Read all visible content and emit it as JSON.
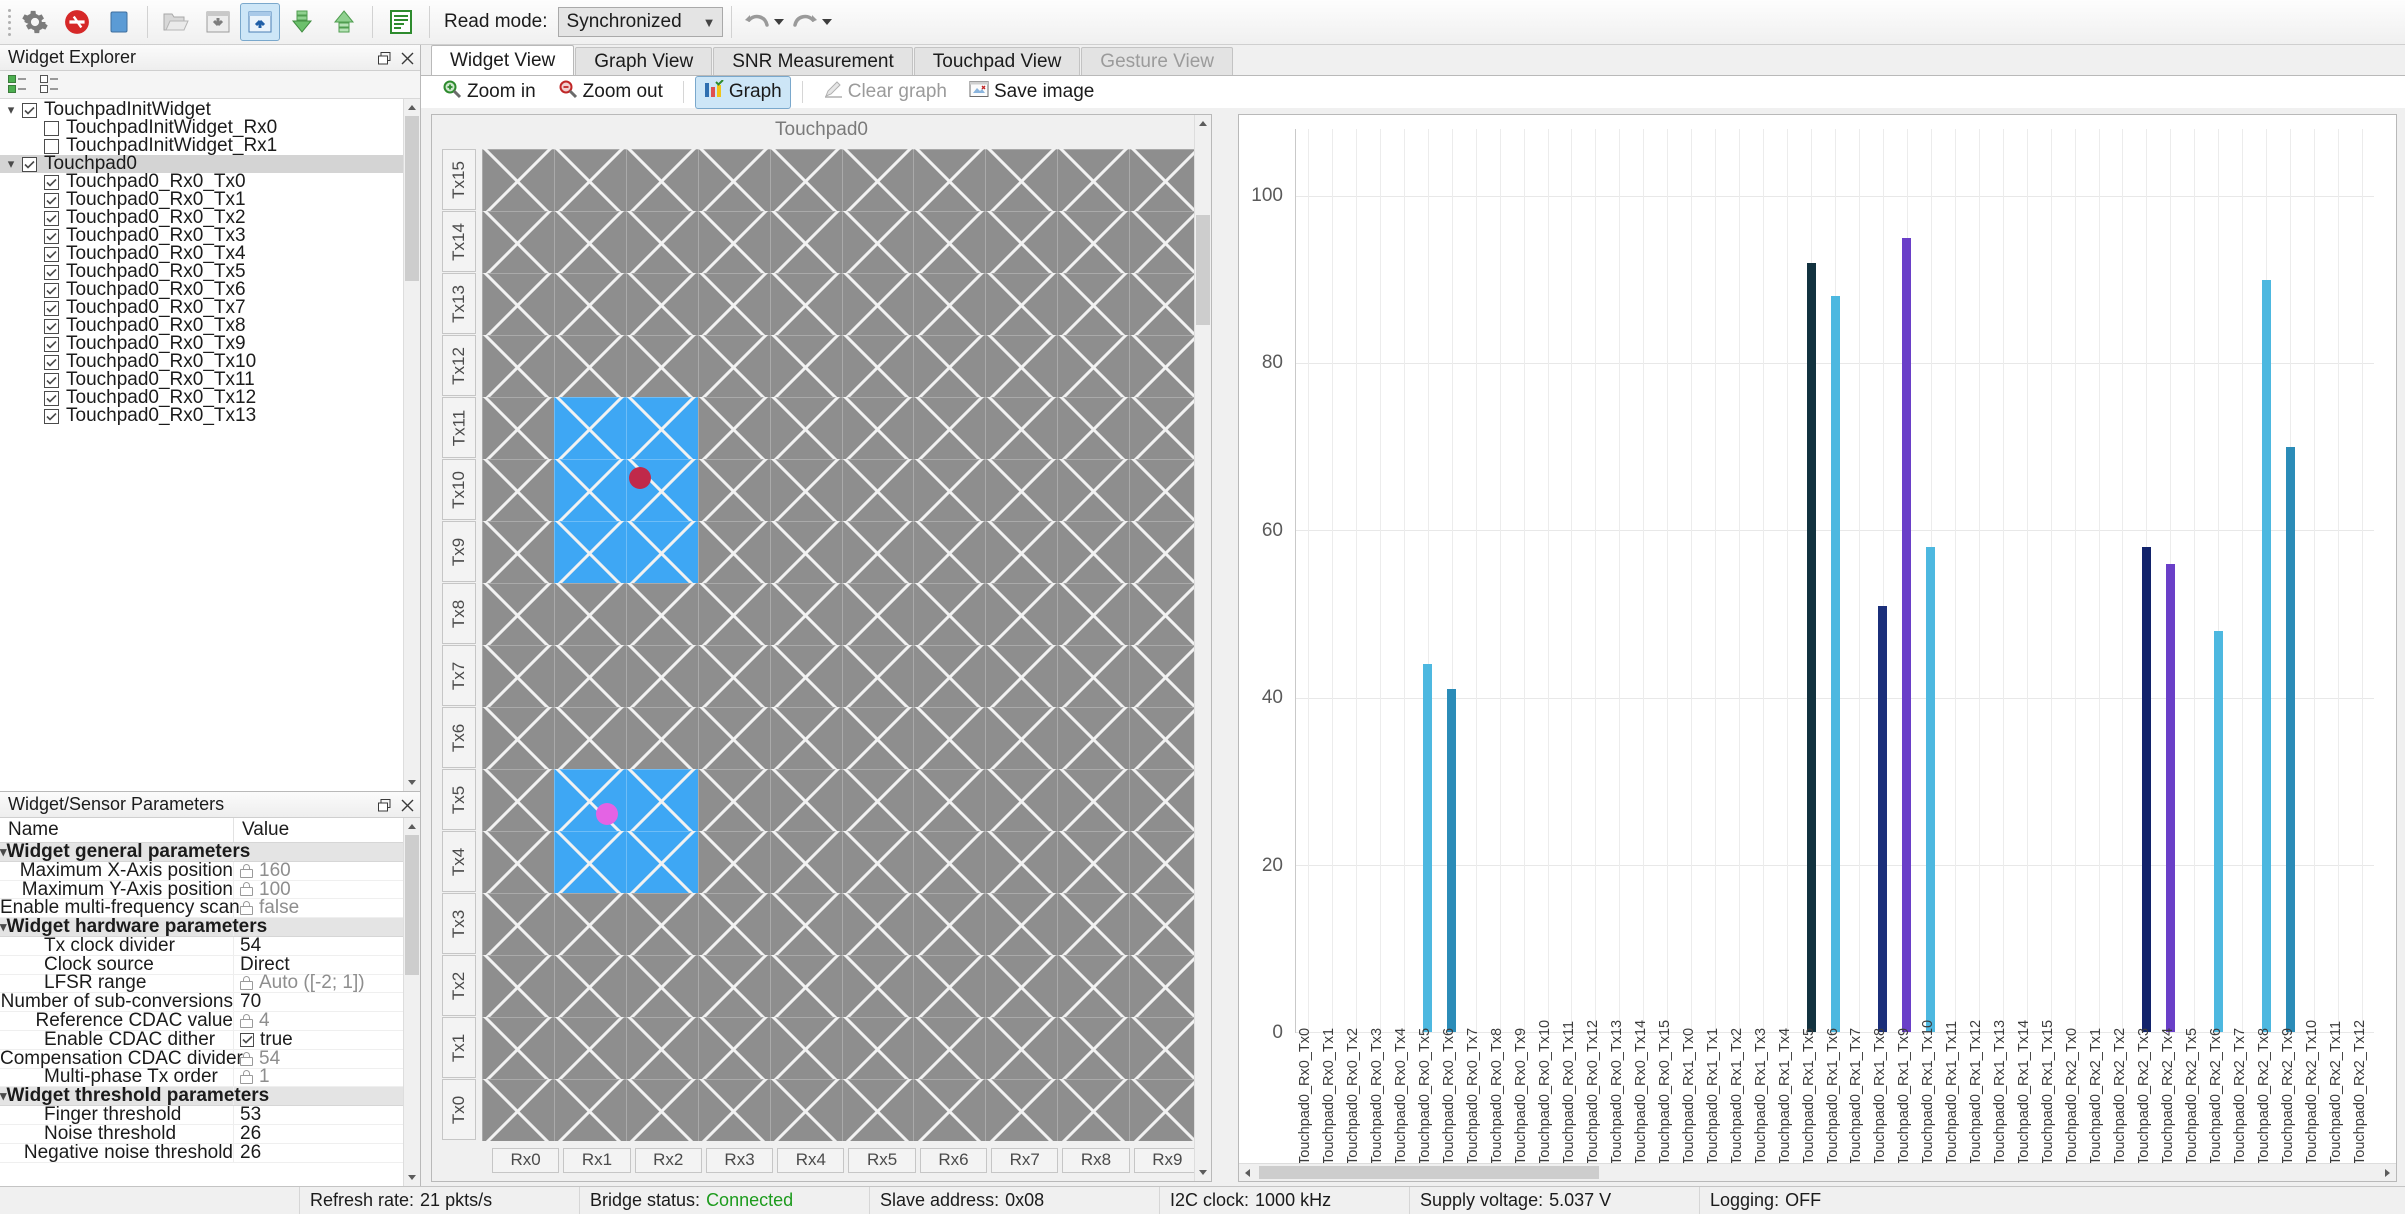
{
  "toolbar": {
    "buttons": [
      {
        "name": "settings-icon",
        "label": "Settings"
      },
      {
        "name": "disconnect-icon",
        "label": "Disconnect"
      },
      {
        "name": "stop-icon",
        "label": "Stop"
      },
      {
        "name": "open-file-icon",
        "label": "Open configuration"
      },
      {
        "name": "read-from-device-icon",
        "label": "Read from device"
      },
      {
        "name": "write-to-device-icon",
        "label": "Write to device"
      },
      {
        "name": "apply-to-device-icon",
        "label": "Apply to device"
      },
      {
        "name": "upload-to-device-icon",
        "label": "Upload to device"
      },
      {
        "name": "log-icon",
        "label": "Log"
      }
    ],
    "read_mode_label": "Read mode:",
    "read_mode_value": "Synchronized",
    "undo_label": "Undo",
    "redo_label": "Redo"
  },
  "widget_explorer": {
    "title": "Widget Explorer",
    "check_all_label": "Check all",
    "uncheck_all_label": "Uncheck all",
    "items": [
      {
        "label": "TouchpadInitWidget",
        "level": 0,
        "checked": true,
        "expandable": true,
        "selected": false
      },
      {
        "label": "TouchpadInitWidget_Rx0",
        "level": 1,
        "checked": false,
        "expandable": false,
        "selected": false
      },
      {
        "label": "TouchpadInitWidget_Rx1",
        "level": 1,
        "checked": false,
        "expandable": false,
        "selected": false
      },
      {
        "label": "Touchpad0",
        "level": 0,
        "checked": true,
        "expandable": true,
        "selected": true
      },
      {
        "label": "Touchpad0_Rx0_Tx0",
        "level": 1,
        "checked": true,
        "expandable": false,
        "selected": false
      },
      {
        "label": "Touchpad0_Rx0_Tx1",
        "level": 1,
        "checked": true,
        "expandable": false,
        "selected": false
      },
      {
        "label": "Touchpad0_Rx0_Tx2",
        "level": 1,
        "checked": true,
        "expandable": false,
        "selected": false
      },
      {
        "label": "Touchpad0_Rx0_Tx3",
        "level": 1,
        "checked": true,
        "expandable": false,
        "selected": false
      },
      {
        "label": "Touchpad0_Rx0_Tx4",
        "level": 1,
        "checked": true,
        "expandable": false,
        "selected": false
      },
      {
        "label": "Touchpad0_Rx0_Tx5",
        "level": 1,
        "checked": true,
        "expandable": false,
        "selected": false
      },
      {
        "label": "Touchpad0_Rx0_Tx6",
        "level": 1,
        "checked": true,
        "expandable": false,
        "selected": false
      },
      {
        "label": "Touchpad0_Rx0_Tx7",
        "level": 1,
        "checked": true,
        "expandable": false,
        "selected": false
      },
      {
        "label": "Touchpad0_Rx0_Tx8",
        "level": 1,
        "checked": true,
        "expandable": false,
        "selected": false
      },
      {
        "label": "Touchpad0_Rx0_Tx9",
        "level": 1,
        "checked": true,
        "expandable": false,
        "selected": false
      },
      {
        "label": "Touchpad0_Rx0_Tx10",
        "level": 1,
        "checked": true,
        "expandable": false,
        "selected": false
      },
      {
        "label": "Touchpad0_Rx0_Tx11",
        "level": 1,
        "checked": true,
        "expandable": false,
        "selected": false
      },
      {
        "label": "Touchpad0_Rx0_Tx12",
        "level": 1,
        "checked": true,
        "expandable": false,
        "selected": false
      },
      {
        "label": "Touchpad0_Rx0_Tx13",
        "level": 1,
        "checked": true,
        "expandable": false,
        "selected": false
      }
    ]
  },
  "parameters_panel": {
    "title": "Widget/Sensor Parameters",
    "col_name": "Name",
    "col_value": "Value",
    "rows": [
      {
        "name": "Widget general parameters",
        "value": "",
        "group": true
      },
      {
        "name": "Maximum X-Axis position",
        "value": "160",
        "locked": true
      },
      {
        "name": "Maximum Y-Axis position",
        "value": "100",
        "locked": true
      },
      {
        "name": "Enable multi-frequency scan",
        "value": "false",
        "locked": true
      },
      {
        "name": "Widget hardware parameters",
        "value": "",
        "group": true
      },
      {
        "name": "Tx clock divider",
        "value": "54"
      },
      {
        "name": "Clock source",
        "value": "Direct"
      },
      {
        "name": "LFSR range",
        "value": "Auto ([-2; 1])",
        "locked": true
      },
      {
        "name": "Number of sub-conversions",
        "value": "70"
      },
      {
        "name": "Reference CDAC value",
        "value": "4",
        "locked": true
      },
      {
        "name": "Enable CDAC dither",
        "value": "true",
        "checkbox": true
      },
      {
        "name": "Compensation CDAC divider",
        "value": "54",
        "locked": true
      },
      {
        "name": "Multi-phase Tx order",
        "value": "1",
        "locked": true
      },
      {
        "name": "Widget threshold parameters",
        "value": "",
        "group": true
      },
      {
        "name": "Finger threshold",
        "value": "53"
      },
      {
        "name": "Noise threshold",
        "value": "26"
      },
      {
        "name": "Negative noise threshold",
        "value": "26"
      }
    ]
  },
  "tabs": [
    {
      "label": "Widget View",
      "active": true,
      "disabled": false
    },
    {
      "label": "Graph View",
      "active": false,
      "disabled": false
    },
    {
      "label": "SNR Measurement",
      "active": false,
      "disabled": false
    },
    {
      "label": "Touchpad View",
      "active": false,
      "disabled": false
    },
    {
      "label": "Gesture View",
      "active": false,
      "disabled": true
    }
  ],
  "view_toolbar": [
    {
      "label": "Zoom in",
      "icon": "zoom-in-icon",
      "active": false,
      "disabled": false
    },
    {
      "label": "Zoom out",
      "icon": "zoom-out-icon",
      "active": false,
      "disabled": false
    },
    {
      "label": "Graph",
      "icon": "graph-icon",
      "active": true,
      "disabled": false
    },
    {
      "label": "Clear graph",
      "icon": "clear-graph-icon",
      "active": false,
      "disabled": true
    },
    {
      "label": "Save image",
      "icon": "save-image-icon",
      "active": false,
      "disabled": false
    }
  ],
  "touchpad_view": {
    "title": "Touchpad0",
    "tx_labels": [
      "Tx15",
      "Tx14",
      "Tx13",
      "Tx12",
      "Tx11",
      "Tx10",
      "Tx9",
      "Tx8",
      "Tx7",
      "Tx6",
      "Tx5",
      "Tx4",
      "Tx3",
      "Tx2",
      "Tx1",
      "Tx0"
    ],
    "rx_labels": [
      "Rx0",
      "Rx1",
      "Rx2",
      "Rx3",
      "Rx4",
      "Rx5",
      "Rx6",
      "Rx7",
      "Rx8",
      "Rx9"
    ],
    "active_cells": [
      {
        "col": 1,
        "row": 4
      },
      {
        "col": 2,
        "row": 4
      },
      {
        "col": 1,
        "row": 5
      },
      {
        "col": 2,
        "row": 5
      },
      {
        "col": 1,
        "row": 6
      },
      {
        "col": 2,
        "row": 6
      },
      {
        "col": 1,
        "row": 10
      },
      {
        "col": 2,
        "row": 10
      },
      {
        "col": 1,
        "row": 11
      },
      {
        "col": 2,
        "row": 11
      }
    ],
    "touches": [
      {
        "id": "touch-0",
        "color": "#c0294a",
        "col_pct": 22.0,
        "row_pct": 33.2
      },
      {
        "id": "touch-1",
        "color": "#e463e4",
        "col_pct": 17.4,
        "row_pct": 67.0
      }
    ],
    "cell_color": "#8e8e8e",
    "active_color": "#3ea7f4"
  },
  "chart_data": {
    "type": "bar",
    "title": "",
    "xlabel": "",
    "ylabel": "",
    "ylim": [
      0,
      108
    ],
    "yticks": [
      0,
      20,
      40,
      60,
      80,
      100
    ],
    "grid": true,
    "legend": "none",
    "categories": [
      "Touchpad0_Rx0_Tx0",
      "Touchpad0_Rx0_Tx1",
      "Touchpad0_Rx0_Tx2",
      "Touchpad0_Rx0_Tx3",
      "Touchpad0_Rx0_Tx4",
      "Touchpad0_Rx0_Tx5",
      "Touchpad0_Rx0_Tx6",
      "Touchpad0_Rx0_Tx7",
      "Touchpad0_Rx0_Tx8",
      "Touchpad0_Rx0_Tx9",
      "Touchpad0_Rx0_Tx10",
      "Touchpad0_Rx0_Tx11",
      "Touchpad0_Rx0_Tx12",
      "Touchpad0_Rx0_Tx13",
      "Touchpad0_Rx0_Tx14",
      "Touchpad0_Rx0_Tx15",
      "Touchpad0_Rx1_Tx0",
      "Touchpad0_Rx1_Tx1",
      "Touchpad0_Rx1_Tx2",
      "Touchpad0_Rx1_Tx3",
      "Touchpad0_Rx1_Tx4",
      "Touchpad0_Rx1_Tx5",
      "Touchpad0_Rx1_Tx6",
      "Touchpad0_Rx1_Tx7",
      "Touchpad0_Rx1_Tx8",
      "Touchpad0_Rx1_Tx9",
      "Touchpad0_Rx1_Tx10",
      "Touchpad0_Rx1_Tx11",
      "Touchpad0_Rx1_Tx12",
      "Touchpad0_Rx1_Tx13",
      "Touchpad0_Rx1_Tx14",
      "Touchpad0_Rx1_Tx15",
      "Touchpad0_Rx2_Tx0",
      "Touchpad0_Rx2_Tx1",
      "Touchpad0_Rx2_Tx2",
      "Touchpad0_Rx2_Tx3",
      "Touchpad0_Rx2_Tx4",
      "Touchpad0_Rx2_Tx5",
      "Touchpad0_Rx2_Tx6",
      "Touchpad0_Rx2_Tx7",
      "Touchpad0_Rx2_Tx8",
      "Touchpad0_Rx2_Tx9",
      "Touchpad0_Rx2_Tx10",
      "Touchpad0_Rx2_Tx11",
      "Touchpad0_Rx2_Tx12"
    ],
    "values": [
      0,
      0,
      0,
      0,
      0,
      44,
      41,
      0,
      0,
      0,
      0,
      0,
      0,
      0,
      0,
      0,
      0,
      0,
      0,
      0,
      0,
      92,
      88,
      0,
      51,
      95,
      58,
      0,
      0,
      0,
      0,
      0,
      0,
      0,
      0,
      58,
      56,
      0,
      48,
      0,
      90,
      70,
      0,
      0,
      0
    ],
    "bar_colors": [
      "#4db8e0",
      "#4db8e0",
      "#4db8e0",
      "#4db8e0",
      "#4db8e0",
      "#4db8e0",
      "#2b8cb8",
      "#4db8e0",
      "#4db8e0",
      "#4db8e0",
      "#4db8e0",
      "#4db8e0",
      "#4db8e0",
      "#4db8e0",
      "#4db8e0",
      "#4db8e0",
      "#4db8e0",
      "#4db8e0",
      "#4db8e0",
      "#4db8e0",
      "#4db8e0",
      "#12323f",
      "#4db8e0",
      "#4db8e0",
      "#1b2f7a",
      "#6a3fc8",
      "#4db8e0",
      "#4db8e0",
      "#4db8e0",
      "#4db8e0",
      "#4db8e0",
      "#4db8e0",
      "#4db8e0",
      "#4db8e0",
      "#4db8e0",
      "#12236b",
      "#6a3fc8",
      "#4db8e0",
      "#4db8e0",
      "#4db8e0",
      "#4db8e0",
      "#2b8cb8",
      "#4db8e0",
      "#4db8e0",
      "#4db8e0"
    ]
  },
  "status_bar": {
    "refresh_label": "Refresh rate:",
    "refresh_value": "21 pkts/s",
    "bridge_label": "Bridge status:",
    "bridge_value": "Connected",
    "slave_label": "Slave address:",
    "slave_value": "0x08",
    "i2c_label": "I2C clock:",
    "i2c_value": "1000 kHz",
    "supply_label": "Supply voltage:",
    "supply_value": "5.037 V",
    "logging_label": "Logging:",
    "logging_value": "OFF"
  }
}
